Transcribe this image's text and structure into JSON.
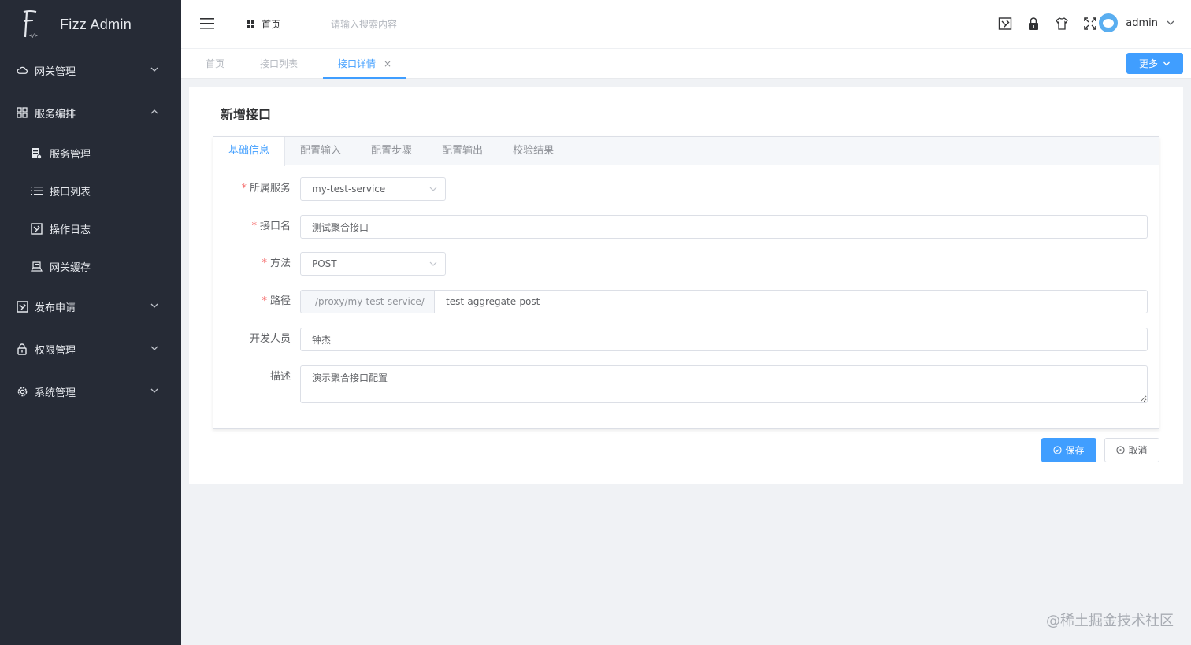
{
  "sidebar": {
    "app_name": "Fizz Admin",
    "logo_mark": "F",
    "menu": [
      {
        "label": "网关管理",
        "icon": "cloud-icon",
        "expanded": false
      },
      {
        "label": "服务编排",
        "icon": "grid-icon",
        "expanded": true
      },
      {
        "label": "发布申请",
        "icon": "publish-icon",
        "expanded": false
      },
      {
        "label": "权限管理",
        "icon": "lock-icon",
        "expanded": false
      },
      {
        "label": "系统管理",
        "icon": "gear-icon",
        "expanded": false
      }
    ],
    "sub_items": [
      {
        "label": "服务管理",
        "icon": "document-icon"
      },
      {
        "label": "接口列表",
        "icon": "list-icon"
      },
      {
        "label": "操作日志",
        "icon": "log-icon"
      },
      {
        "label": "网关缓存",
        "icon": "cache-icon"
      }
    ]
  },
  "header": {
    "breadcrumb": "首页",
    "search_placeholder": "请输入搜索内容",
    "user_name": "admin"
  },
  "page_tabs": [
    {
      "label": "首页",
      "active": false
    },
    {
      "label": "接口列表",
      "active": false
    },
    {
      "label": "接口详情",
      "active": true,
      "close": "×"
    }
  ],
  "more_label": "更多",
  "page_title": "新增接口",
  "card_tabs": [
    {
      "label": "基础信息",
      "active": true
    },
    {
      "label": "配置输入",
      "active": false
    },
    {
      "label": "配置步骤",
      "active": false
    },
    {
      "label": "配置输出",
      "active": false
    },
    {
      "label": "校验结果",
      "active": false
    }
  ],
  "form": {
    "service": {
      "label": "所属服务",
      "required": "*",
      "value": "my-test-service"
    },
    "name": {
      "label": "接口名",
      "required": "*",
      "value": "测试聚合接口"
    },
    "method": {
      "label": "方法",
      "required": "*",
      "value": "POST"
    },
    "path": {
      "label": "路径",
      "required": "*",
      "prefix": "/proxy/my-test-service/",
      "value": "test-aggregate-post"
    },
    "developer": {
      "label": "开发人员",
      "value": "钟杰"
    },
    "description": {
      "label": "描述",
      "value": "演示聚合接口配置"
    }
  },
  "buttons": {
    "save": "保存",
    "cancel": "取消"
  },
  "watermark": "@稀土掘金技术社区",
  "colors": {
    "primary": "#409eff",
    "sidebar_bg": "#262b36",
    "required": "#f56c6c"
  }
}
